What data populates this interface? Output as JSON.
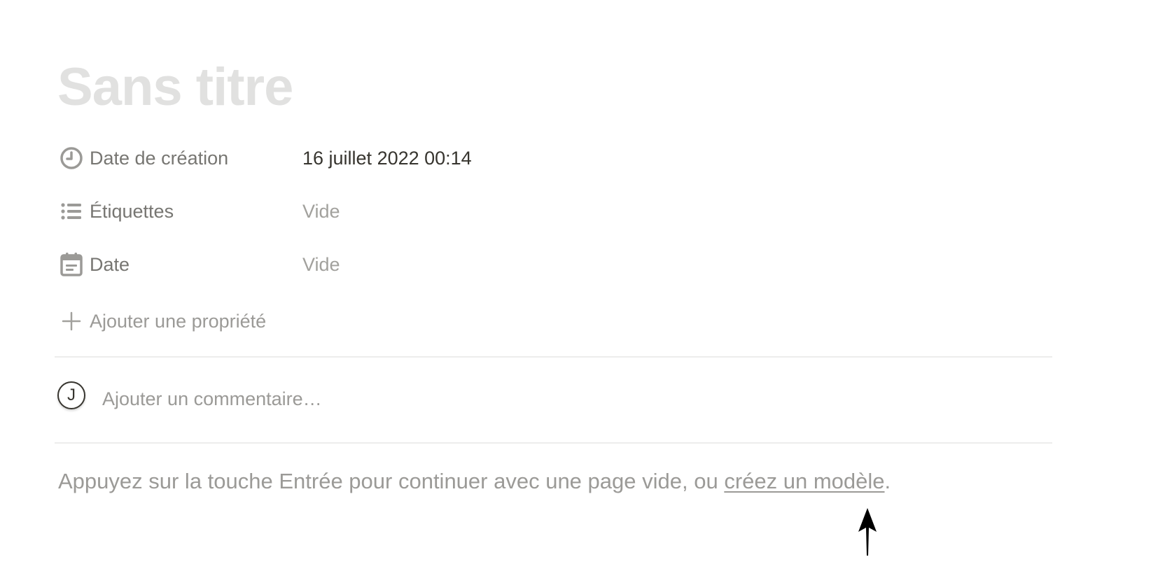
{
  "page": {
    "title_placeholder": "Sans titre"
  },
  "properties": [
    {
      "icon": "clock-icon",
      "name": "Date de création",
      "value": "16 juillet 2022 00:14",
      "empty": false
    },
    {
      "icon": "list-icon",
      "name": "Étiquettes",
      "value": "Vide",
      "empty": true
    },
    {
      "icon": "calendar-icon",
      "name": "Date",
      "value": "Vide",
      "empty": true
    }
  ],
  "add_property_label": "Ajouter une propriété",
  "comment": {
    "avatar_initial": "J",
    "placeholder": "Ajouter un commentaire…"
  },
  "hint": {
    "prefix": "Appuyez sur la touche Entrée pour continuer avec une page vide, ou ",
    "link": "créez un modèle",
    "suffix": "."
  },
  "colors": {
    "title_placeholder": "#e1e1e0",
    "text_muted": "#9b9a97",
    "text_primary": "#37352f",
    "divider": "#ededec"
  }
}
